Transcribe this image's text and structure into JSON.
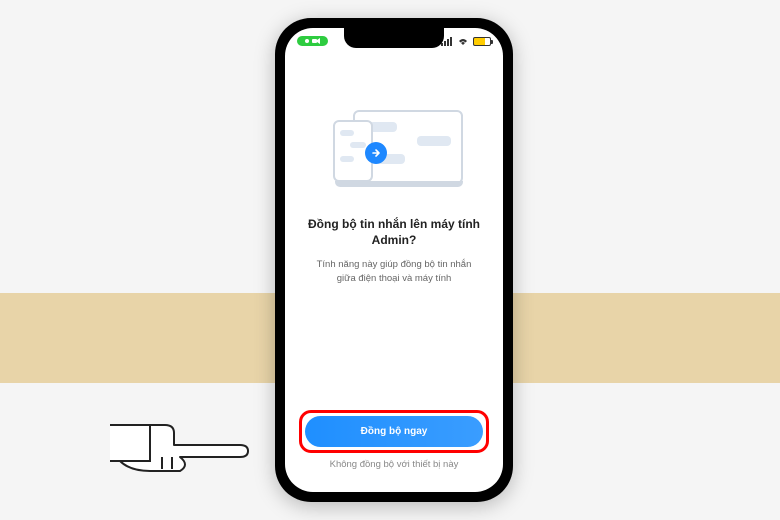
{
  "status_bar": {
    "recording_indicator": "● REC"
  },
  "sync_prompt": {
    "heading": "Đồng bộ tin nhắn lên máy tính Admin?",
    "description": "Tính năng này giúp đồng bộ tin nhắn giữa điện thoại và máy tính",
    "primary_button_label": "Đồng bộ ngay",
    "secondary_link_label": "Không đồng bộ với thiết bị này"
  },
  "colors": {
    "primary": "#1e88ff",
    "highlight": "#ff0000",
    "recording": "#2ecc40",
    "battery": "#ffcc00"
  }
}
